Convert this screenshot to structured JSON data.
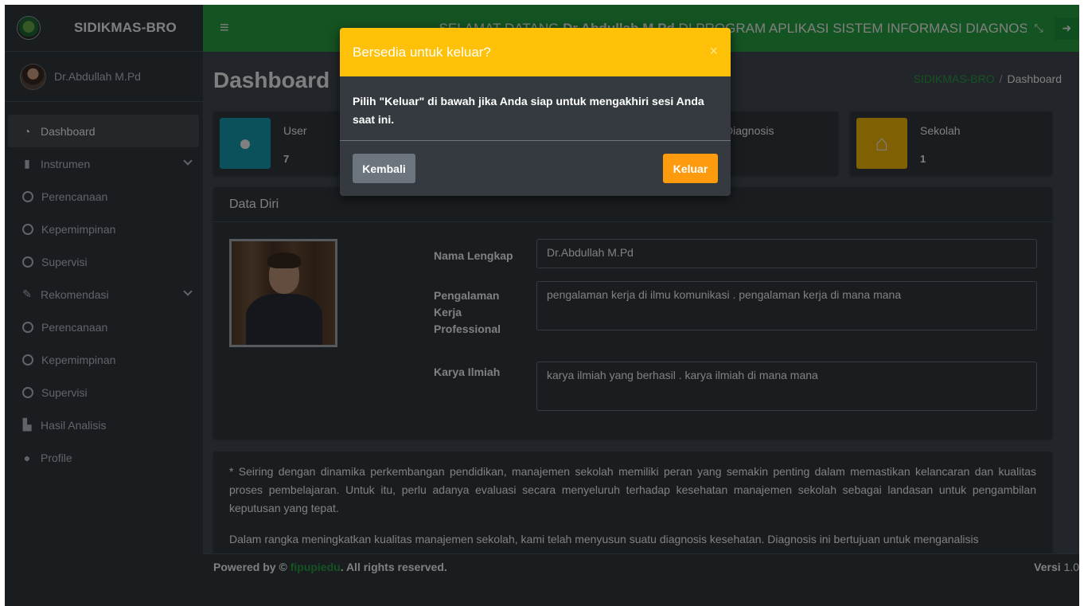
{
  "sidebar": {
    "brand": "SIDIKMAS-BRO",
    "user_name": "Dr.Abdullah M.Pd",
    "nav": {
      "dashboard": "Dashboard",
      "instrumen": "Instrumen",
      "instrumen_items": [
        "Perencanaan",
        "Kepemimpinan",
        "Supervisi"
      ],
      "rekomendasi": "Rekomendasi",
      "rekomendasi_items": [
        "Perencanaan",
        "Kepemimpinan",
        "Supervisi"
      ],
      "hasil_analisis": "Hasil Analisis",
      "profile": "Profile"
    }
  },
  "header": {
    "welcome_prefix": "SELAMAT DATANG ",
    "welcome_name": "Dr.Abdullah M.Pd",
    "welcome_suffix": " DI PROGRAM APLIKASI SISTEM INFORMASI DIAGNOSIS"
  },
  "page": {
    "title": "Dashboard",
    "breadcrumb_link": "SIDIKMAS-BRO",
    "breadcrumb_current": "Dashboard"
  },
  "info_boxes": {
    "user": {
      "label": "User",
      "value": "7"
    },
    "diagnosis": {
      "label": "Diagnosis",
      "value": ""
    },
    "sekolah": {
      "label": "Sekolah",
      "value": "1"
    }
  },
  "data_diri": {
    "title": "Data Diri",
    "nama_label": "Nama Lengkap",
    "nama_value": "Dr.Abdullah M.Pd",
    "pengalaman_label": "Pengalaman Kerja Professional",
    "pengalaman_value": "pengalaman kerja di ilmu komunikasi . pengalaman kerja di mana mana",
    "karya_label": "Karya Ilmiah",
    "karya_value": "karya ilmiah yang berhasil . karya ilmiah di mana mana"
  },
  "description": {
    "p1": "* Seiring dengan dinamika perkembangan pendidikan, manajemen sekolah memiliki peran yang semakin penting dalam memastikan kelancaran dan kualitas proses pembelajaran. Untuk itu, perlu adanya evaluasi secara menyeluruh terhadap kesehatan manajemen sekolah sebagai landasan untuk pengambilan keputusan yang tepat.",
    "p2": "Dalam rangka meningkatkan kualitas manajemen sekolah, kami telah menyusun suatu diagnosis kesehatan. Diagnosis ini bertujuan untuk menganalisis"
  },
  "footer": {
    "powered": "Powered by © ",
    "brand": "fipupiedu",
    "rights": ". All rights reserved.",
    "version_label": "Versi",
    "version_value": " 1.0"
  },
  "modal": {
    "title": "Bersedia untuk keluar?",
    "close": "×",
    "body": "Pilih \"Keluar\" di bawah jika Anda siap untuk mengakhiri sesi Anda saat ini.",
    "back_label": "Kembali",
    "logout_label": "Keluar"
  },
  "colors": {
    "header": "#28a745",
    "sidebar": "#343a40",
    "modal_header": "#ffc107",
    "logout_button": "#fd9a0e",
    "user_icon": "#17a2b8",
    "sekolah_icon": "#ffc107"
  },
  "icons": {
    "menu": "hamburger-icon",
    "fullscreen": "compress-icon",
    "logout": "sign-out-icon"
  }
}
